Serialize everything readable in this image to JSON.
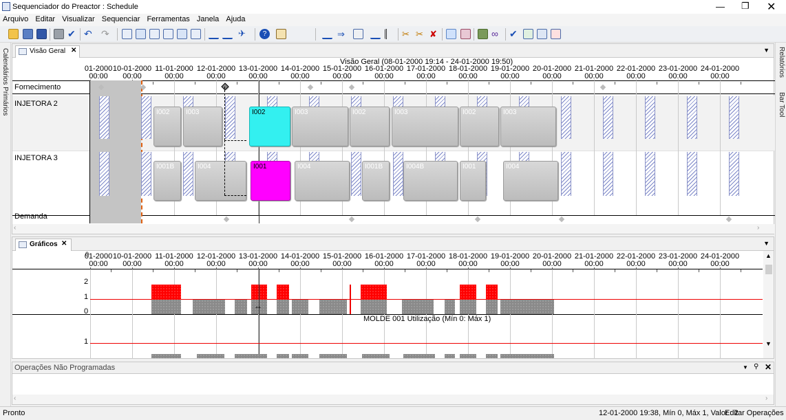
{
  "window": {
    "title": "Sequenciador do Preactor : Schedule",
    "icon": "app-icon"
  },
  "menu": [
    "Arquivo",
    "Editar",
    "Visualizar",
    "Sequenciar",
    "Ferramentas",
    "Janela",
    "Ajuda"
  ],
  "side_left": {
    "label": "Calendários Primários"
  },
  "side_right": {
    "tabs": [
      "Relatórios",
      "Bar Tool"
    ]
  },
  "overview": {
    "tab_label": "Visão Geral",
    "header": "Visão Geral   (08-01-2000 19:14 - 24-01-2000 19:50)",
    "dates": [
      "01-2000",
      "10-01-2000",
      "11-01-2000",
      "12-01-2000",
      "13-01-2000",
      "14-01-2000",
      "15-01-2000",
      "16-01-2000",
      "17-01-2000",
      "18-01-2000",
      "19-01-2000",
      "20-01-2000",
      "21-01-2000",
      "22-01-2000",
      "23-01-2000",
      "24-01-2000"
    ],
    "time": "00:00",
    "rows": [
      "Fornecimento",
      "INJETORA 2",
      "INJETORA 3",
      "Demanda"
    ],
    "ops_row2": [
      "I002",
      "I003",
      "I002",
      "I003",
      "I002",
      "I003",
      "I002",
      "I003"
    ],
    "ops_row3": [
      "I001B",
      "I004",
      "I001",
      "I004",
      "I001B",
      "I004B",
      "I001",
      "I004"
    ]
  },
  "graphs": {
    "tab_label": "Gráficos",
    "dates": [
      "01-2000",
      "10-01-2000",
      "11-01-2000",
      "12-01-2000",
      "13-01-2000",
      "14-01-2000",
      "15-01-2000",
      "16-01-2000",
      "17-01-2000",
      "18-01-2000",
      "19-01-2000",
      "20-01-2000",
      "21-01-2000",
      "22-01-2000",
      "23-01-2000",
      "24-01-2000"
    ],
    "time": "00:00",
    "y_labels": [
      "2",
      "1",
      "0"
    ],
    "caption": "MOLDE 001 Utilização (Mín 0: Máx 1)",
    "y2_label": "1",
    "top_clip": "0"
  },
  "unscheduled": {
    "title": "Operações Não Programadas"
  },
  "status": {
    "left": "Pronto",
    "right": "12-01-2000 19:38, Mín 0, Máx 1, Valor : 2",
    "mode": "Editar Operações"
  },
  "colors": {
    "cyan": "#33f0f0",
    "magenta": "#ff00ff",
    "red": "#ff0000",
    "accent": "#1a4fb5"
  }
}
